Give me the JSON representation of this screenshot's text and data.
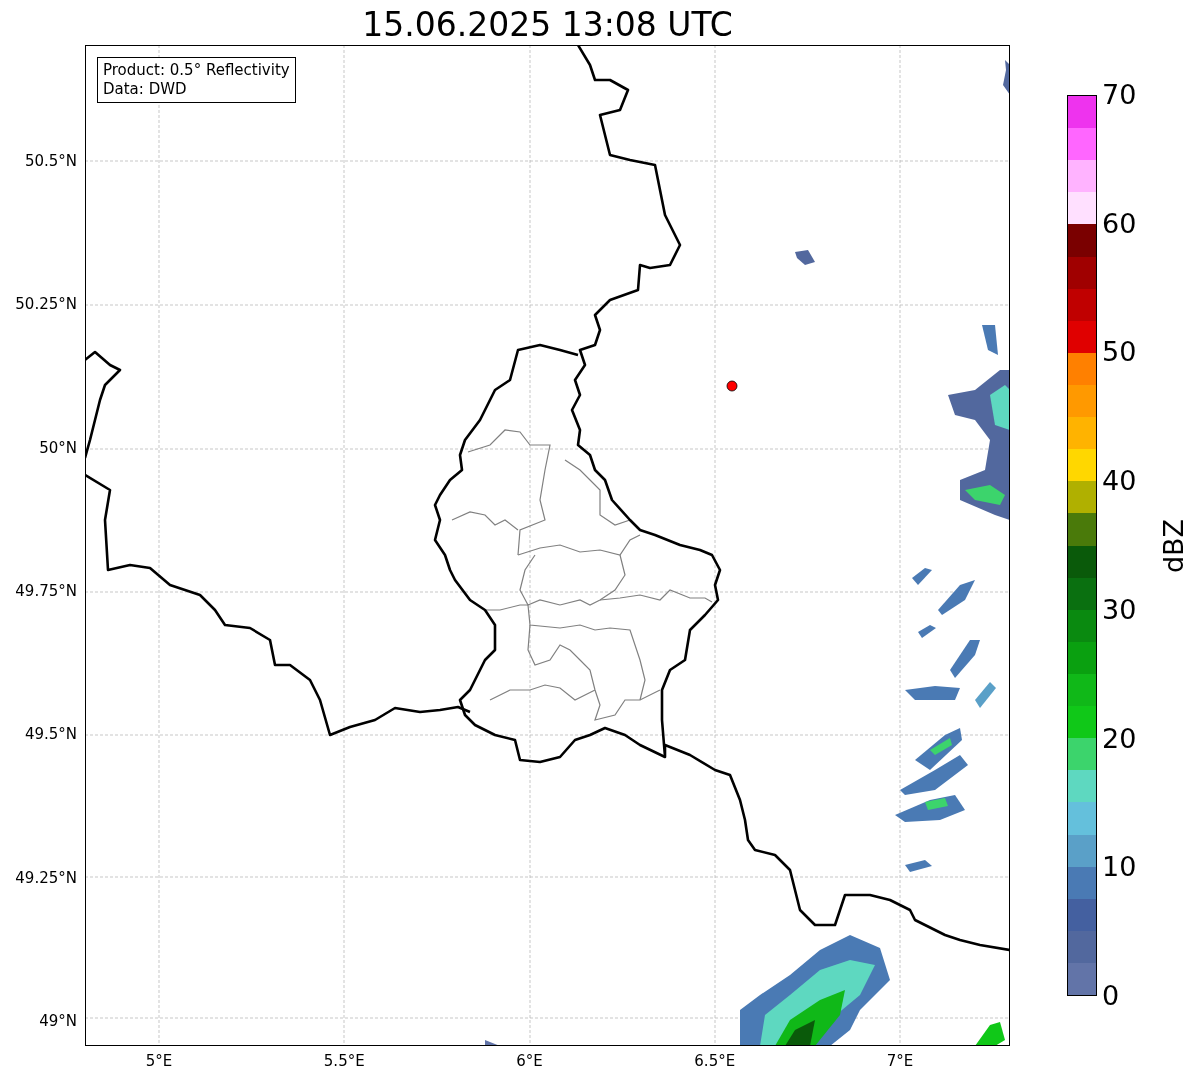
{
  "title": "15.06.2025 13:08 UTC",
  "info_box": [
    "Product: 0.5° Reflectivity",
    "Data: DWD"
  ],
  "y_ticks": [
    "50.5°N",
    "50.25°N",
    "50°N",
    "49.75°N",
    "49.5°N",
    "49.25°N",
    "49°N"
  ],
  "x_ticks": [
    "5°E",
    "5.5°E",
    "6°E",
    "6.5°E",
    "7°E"
  ],
  "colorbar": {
    "label": "dBZ",
    "ticks": [
      "70",
      "60",
      "50",
      "40",
      "30",
      "20",
      "10",
      "0"
    ],
    "bands": [
      {
        "color": "#ee33ee"
      },
      {
        "color": "#ff66ff"
      },
      {
        "color": "#ffb3ff"
      },
      {
        "color": "#ffe0ff"
      },
      {
        "color": "#7a0000"
      },
      {
        "color": "#a00000"
      },
      {
        "color": "#c00000"
      },
      {
        "color": "#e00000"
      },
      {
        "color": "#ff8000"
      },
      {
        "color": "#ff9900"
      },
      {
        "color": "#ffb300"
      },
      {
        "color": "#ffd700"
      },
      {
        "color": "#b0b000"
      },
      {
        "color": "#4a7a0a"
      },
      {
        "color": "#0a5a0a"
      },
      {
        "color": "#0a7010"
      },
      {
        "color": "#0a8a10"
      },
      {
        "color": "#0aa010"
      },
      {
        "color": "#10b818"
      },
      {
        "color": "#10c818"
      },
      {
        "color": "#3cd46c"
      },
      {
        "color": "#5ed8c0"
      },
      {
        "color": "#64c0dc"
      },
      {
        "color": "#5aa0c8"
      },
      {
        "color": "#4a7ab4"
      },
      {
        "color": "#4460a0"
      },
      {
        "color": "#52689e"
      },
      {
        "color": "#6274a8"
      }
    ]
  }
}
